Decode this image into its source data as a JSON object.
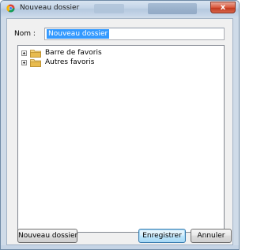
{
  "window": {
    "title": "Nouveau dossier",
    "close_label": "x"
  },
  "form": {
    "name_label": "Nom :",
    "name_value": "Nouveau dossier"
  },
  "tree": {
    "items": [
      {
        "label": "Barre de favoris",
        "expander": "+"
      },
      {
        "label": "Autres favoris",
        "expander": "+"
      }
    ]
  },
  "buttons": {
    "new_folder": "Nouveau dossier",
    "save": "Enregistrer",
    "cancel": "Annuler"
  },
  "colors": {
    "selection": "#3399ff",
    "folder": "#e8c15a",
    "close": "#c7432a"
  },
  "icons": {
    "app": "chrome-icon",
    "folder": "folder-icon",
    "expander": "plus-box-icon"
  }
}
